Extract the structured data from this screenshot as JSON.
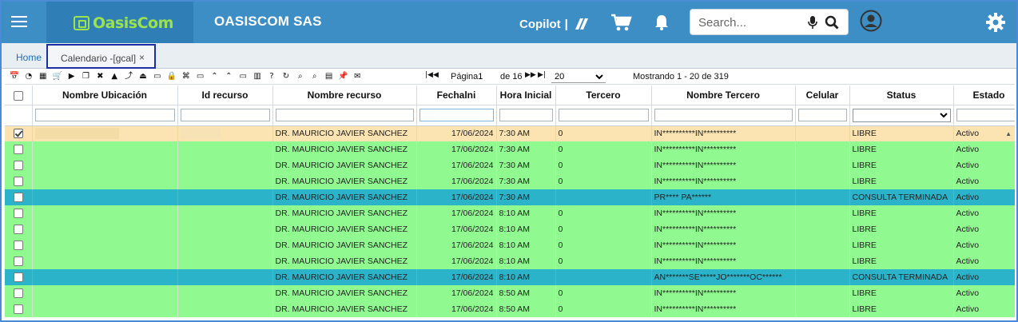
{
  "app": {
    "logo_text": "OasisCom",
    "company": "OASISCOM SAS",
    "copilot_label": "Copilot",
    "copilot_sep": "|"
  },
  "search": {
    "placeholder": "Search..."
  },
  "icons": {
    "menu": "hamburger-menu-icon",
    "cart": "cart-icon",
    "bell": "bell-icon",
    "mic": "mic-icon",
    "search": "search-icon",
    "avatar": "user-avatar-icon",
    "settings": "gear-icon"
  },
  "tabs": {
    "home": "Home",
    "active": "Calendario -[gcal]",
    "close": "×"
  },
  "toolbar": {
    "icons": [
      "📅",
      "◔",
      "▦",
      "🛒",
      "▶",
      "❐",
      "✖",
      "▲",
      "⤴",
      "⏏",
      "▭",
      "🔒",
      "⌘",
      "▭",
      "⌃",
      "⌃",
      "▭",
      "▥",
      "?",
      "↻",
      "⌕",
      "⌕",
      "▤",
      "📌",
      "✉"
    ],
    "page_label": "Página",
    "page_value": "1",
    "page_total": "de 16",
    "rows_per_page": "20",
    "rows_options": [
      "20"
    ],
    "showing": "Mostrando 1 - 20 de 319"
  },
  "colors": {
    "topbar": "#3d8ec4",
    "row_green": "#90f990",
    "row_teal": "#2bb3c9",
    "row_selected": "#fbe3b2"
  },
  "grid": {
    "columns": [
      "Nombre Ubicación",
      "Id recurso",
      "Nombre recurso",
      "Fechalni",
      "Hora Inicial",
      "Tercero",
      "Nombre Tercero",
      "Celular",
      "Status",
      "Estado"
    ],
    "rows": [
      {
        "kind": "sel",
        "checked": true,
        "recurso": "DR. MAURICIO JAVIER SANCHEZ",
        "fecha": "17/06/2024",
        "hora": "7:30 AM",
        "tercero": "0",
        "nombre_tercero": "IN**********IN**********",
        "celular": "",
        "status": "LIBRE",
        "estado": "Activo"
      },
      {
        "kind": "green",
        "checked": false,
        "recurso": "DR. MAURICIO JAVIER SANCHEZ",
        "fecha": "17/06/2024",
        "hora": "7:30 AM",
        "tercero": "0",
        "nombre_tercero": "IN**********IN**********",
        "celular": "",
        "status": "LIBRE",
        "estado": "Activo"
      },
      {
        "kind": "green",
        "checked": false,
        "recurso": "DR. MAURICIO JAVIER SANCHEZ",
        "fecha": "17/06/2024",
        "hora": "7:30 AM",
        "tercero": "0",
        "nombre_tercero": "IN**********IN**********",
        "celular": "",
        "status": "LIBRE",
        "estado": "Activo"
      },
      {
        "kind": "green",
        "checked": false,
        "recurso": "DR. MAURICIO JAVIER SANCHEZ",
        "fecha": "17/06/2024",
        "hora": "7:30 AM",
        "tercero": "0",
        "nombre_tercero": "IN**********IN**********",
        "celular": "",
        "status": "LIBRE",
        "estado": "Activo"
      },
      {
        "kind": "teal",
        "checked": false,
        "recurso": "DR. MAURICIO JAVIER SANCHEZ",
        "fecha": "17/06/2024",
        "hora": "7:30 AM",
        "tercero": "",
        "nombre_tercero": "PR**** PA******",
        "celular": "",
        "status": "CONSULTA TERMINADA",
        "estado": "Activo"
      },
      {
        "kind": "green",
        "checked": false,
        "recurso": "DR. MAURICIO JAVIER SANCHEZ",
        "fecha": "17/06/2024",
        "hora": "8:10 AM",
        "tercero": "0",
        "nombre_tercero": "IN**********IN**********",
        "celular": "",
        "status": "LIBRE",
        "estado": "Activo"
      },
      {
        "kind": "green",
        "checked": false,
        "recurso": "DR. MAURICIO JAVIER SANCHEZ",
        "fecha": "17/06/2024",
        "hora": "8:10 AM",
        "tercero": "0",
        "nombre_tercero": "IN**********IN**********",
        "celular": "",
        "status": "LIBRE",
        "estado": "Activo"
      },
      {
        "kind": "green",
        "checked": false,
        "recurso": "DR. MAURICIO JAVIER SANCHEZ",
        "fecha": "17/06/2024",
        "hora": "8:10 AM",
        "tercero": "0",
        "nombre_tercero": "IN**********IN**********",
        "celular": "",
        "status": "LIBRE",
        "estado": "Activo"
      },
      {
        "kind": "green",
        "checked": false,
        "recurso": "DR. MAURICIO JAVIER SANCHEZ",
        "fecha": "17/06/2024",
        "hora": "8:10 AM",
        "tercero": "0",
        "nombre_tercero": "IN**********IN**********",
        "celular": "",
        "status": "LIBRE",
        "estado": "Activo"
      },
      {
        "kind": "teal",
        "checked": false,
        "recurso": "DR. MAURICIO JAVIER SANCHEZ",
        "fecha": "17/06/2024",
        "hora": "8:10 AM",
        "tercero": "",
        "nombre_tercero": "AN*******SE*****JO*******OC******",
        "celular": "",
        "status": "CONSULTA TERMINADA",
        "estado": "Activo"
      },
      {
        "kind": "green",
        "checked": false,
        "recurso": "DR. MAURICIO JAVIER SANCHEZ",
        "fecha": "17/06/2024",
        "hora": "8:50 AM",
        "tercero": "0",
        "nombre_tercero": "IN**********IN**********",
        "celular": "",
        "status": "LIBRE",
        "estado": "Activo"
      },
      {
        "kind": "green",
        "checked": false,
        "recurso": "DR. MAURICIO JAVIER SANCHEZ",
        "fecha": "17/06/2024",
        "hora": "8:50 AM",
        "tercero": "0",
        "nombre_tercero": "IN**********IN**********",
        "celular": "",
        "status": "LIBRE",
        "estado": "Activo"
      }
    ]
  }
}
